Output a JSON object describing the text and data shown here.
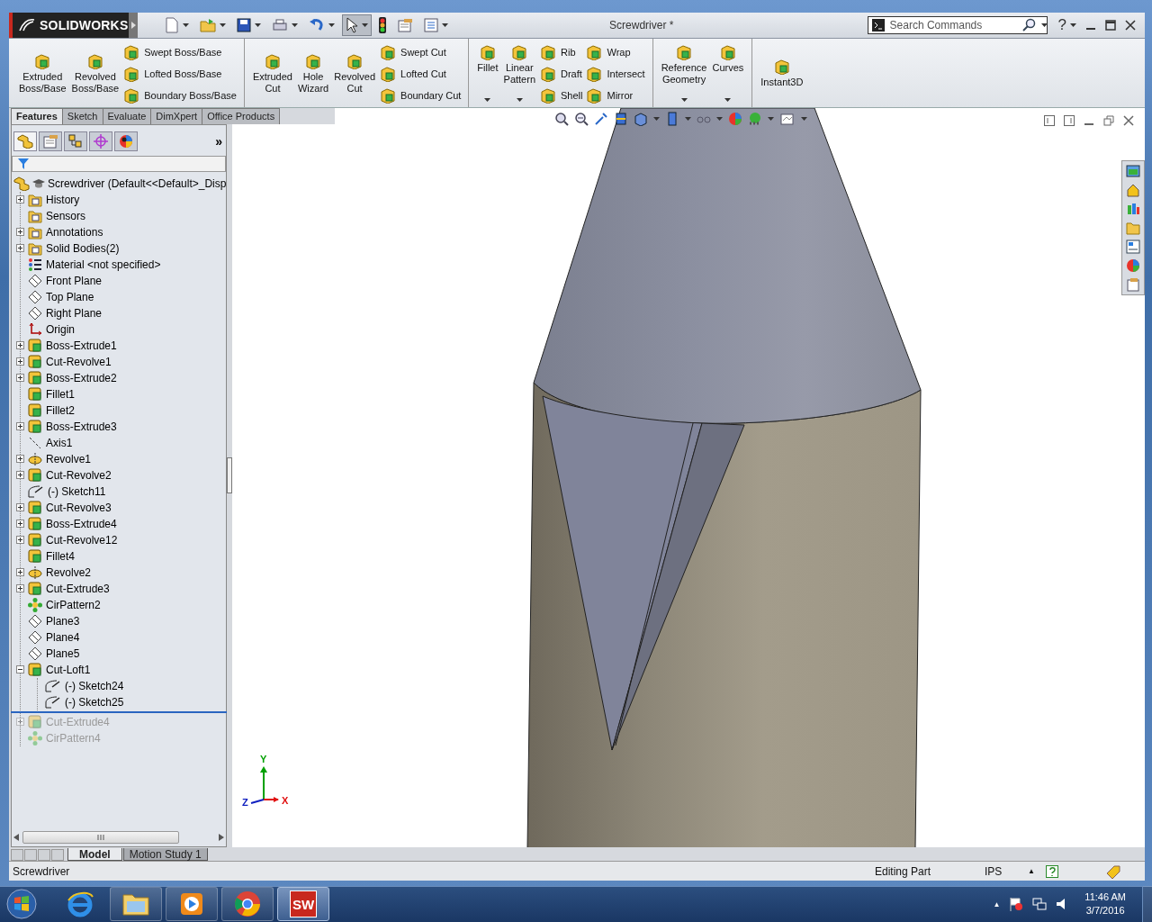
{
  "titlebar": {
    "logo": "SOLIDWORKS",
    "title": "Screwdriver *",
    "search": {
      "placeholder": "Search Commands"
    },
    "help": "?",
    "quick_tools": [
      {
        "kind": "new",
        "dropdown": true,
        "pressed": false
      },
      {
        "kind": "open",
        "dropdown": true,
        "pressed": false
      },
      {
        "kind": "save",
        "dropdown": true,
        "pressed": false
      },
      {
        "kind": "print",
        "dropdown": true,
        "pressed": false
      },
      {
        "kind": "undo",
        "dropdown": true,
        "pressed": false
      },
      {
        "kind": "select",
        "dropdown": true,
        "pressed": true
      },
      {
        "kind": "rebuild",
        "dropdown": false,
        "pressed": false
      },
      {
        "kind": "options",
        "dropdown": false,
        "pressed": false
      },
      {
        "kind": "list",
        "dropdown": true,
        "pressed": false
      }
    ]
  },
  "ribbon": {
    "groups": [
      {
        "columns": [
          {
            "kind": "large",
            "label": "Extruded\nBoss/Base",
            "dropdown": false
          },
          {
            "kind": "large",
            "label": "Revolved\nBoss/Base",
            "dropdown": false
          },
          {
            "kind": "stack",
            "items": [
              {
                "label": "Swept Boss/Base"
              },
              {
                "label": "Lofted Boss/Base"
              },
              {
                "label": "Boundary Boss/Base"
              }
            ]
          }
        ]
      },
      {
        "columns": [
          {
            "kind": "large",
            "label": "Extruded\nCut",
            "dropdown": false
          },
          {
            "kind": "large",
            "label": "Hole\nWizard",
            "dropdown": false
          },
          {
            "kind": "large",
            "label": "Revolved\nCut",
            "dropdown": false
          },
          {
            "kind": "stack",
            "items": [
              {
                "label": "Swept Cut"
              },
              {
                "label": "Lofted Cut"
              },
              {
                "label": "Boundary Cut"
              }
            ]
          }
        ]
      },
      {
        "columns": [
          {
            "kind": "large",
            "label": "Fillet",
            "dropdown": true
          },
          {
            "kind": "large",
            "label": "Linear\nPattern",
            "dropdown": true
          },
          {
            "kind": "stack",
            "items": [
              {
                "label": "Rib"
              },
              {
                "label": "Draft"
              },
              {
                "label": "Shell"
              }
            ]
          },
          {
            "kind": "stack",
            "items": [
              {
                "label": "Wrap"
              },
              {
                "label": "Intersect"
              },
              {
                "label": "Mirror"
              }
            ]
          }
        ]
      },
      {
        "columns": [
          {
            "kind": "large",
            "label": "Reference\nGeometry",
            "dropdown": true
          },
          {
            "kind": "large",
            "label": "Curves",
            "dropdown": true
          }
        ]
      },
      {
        "columns": [
          {
            "kind": "large",
            "label": "Instant3D",
            "dropdown": false
          }
        ]
      }
    ]
  },
  "command_tabs": [
    {
      "label": "Features",
      "selected": true
    },
    {
      "label": "Sketch",
      "selected": false
    },
    {
      "label": "Evaluate",
      "selected": false
    },
    {
      "label": "DimXpert",
      "selected": false
    },
    {
      "label": "Office Products",
      "selected": false
    }
  ],
  "feature_manager": {
    "tabs": [
      {
        "kind": "tree",
        "selected": true
      },
      {
        "kind": "properties",
        "selected": false
      },
      {
        "kind": "configurations",
        "selected": false
      },
      {
        "kind": "target",
        "selected": false
      },
      {
        "kind": "display",
        "selected": false
      }
    ],
    "more": "»",
    "tree": {
      "root": {
        "label": "Screwdriver  (Default<<Default>_Disp"
      },
      "items": [
        {
          "label": "History",
          "kind": "folder",
          "expanded": false,
          "rolled_back": false
        },
        {
          "label": "Sensors",
          "kind": "folder",
          "rolled_back": false
        },
        {
          "label": "Annotations",
          "kind": "folder",
          "expanded": false,
          "rolled_back": false
        },
        {
          "label": "Solid Bodies(2)",
          "kind": "folder",
          "expanded": false,
          "rolled_back": false
        },
        {
          "label": "Material <not specified>",
          "kind": "material",
          "rolled_back": false
        },
        {
          "label": "Front Plane",
          "kind": "plane",
          "rolled_back": false
        },
        {
          "label": "Top Plane",
          "kind": "plane",
          "rolled_back": false
        },
        {
          "label": "Right Plane",
          "kind": "plane",
          "rolled_back": false
        },
        {
          "label": "Origin",
          "kind": "origin",
          "rolled_back": false
        },
        {
          "label": "Boss-Extrude1",
          "kind": "feature",
          "expanded": false,
          "rolled_back": false
        },
        {
          "label": "Cut-Revolve1",
          "kind": "feature",
          "expanded": false,
          "rolled_back": false
        },
        {
          "label": "Boss-Extrude2",
          "kind": "feature",
          "expanded": false,
          "rolled_back": false
        },
        {
          "label": "Fillet1",
          "kind": "feature",
          "rolled_back": false
        },
        {
          "label": "Fillet2",
          "kind": "feature",
          "rolled_back": false
        },
        {
          "label": "Boss-Extrude3",
          "kind": "feature",
          "expanded": false,
          "rolled_back": false
        },
        {
          "label": "Axis1",
          "kind": "axis",
          "rolled_back": false
        },
        {
          "label": "Revolve1",
          "kind": "revolve",
          "expanded": false,
          "rolled_back": false
        },
        {
          "label": "Cut-Revolve2",
          "kind": "feature",
          "expanded": false,
          "rolled_back": false
        },
        {
          "label": "(-) Sketch11",
          "kind": "sketch",
          "rolled_back": false
        },
        {
          "label": "Cut-Revolve3",
          "kind": "feature",
          "expanded": false,
          "rolled_back": false
        },
        {
          "label": "Boss-Extrude4",
          "kind": "feature",
          "expanded": false,
          "rolled_back": false
        },
        {
          "label": "Cut-Revolve12",
          "kind": "feature",
          "expanded": false,
          "rolled_back": false
        },
        {
          "label": "Fillet4",
          "kind": "feature",
          "rolled_back": false
        },
        {
          "label": "Revolve2",
          "kind": "revolve",
          "expanded": false,
          "rolled_back": false
        },
        {
          "label": "Cut-Extrude3",
          "kind": "feature",
          "expanded": false,
          "rolled_back": false
        },
        {
          "label": "CirPattern2",
          "kind": "pattern",
          "rolled_back": false
        },
        {
          "label": "Plane3",
          "kind": "plane",
          "rolled_back": false
        },
        {
          "label": "Plane4",
          "kind": "plane",
          "rolled_back": false
        },
        {
          "label": "Plane5",
          "kind": "plane",
          "rolled_back": false
        },
        {
          "label": "Cut-Loft1",
          "kind": "feature",
          "expanded": true,
          "rolled_back": false,
          "children": [
            {
              "label": "(-) Sketch24",
              "kind": "sketch",
              "rolled_back": false
            },
            {
              "label": "(-) Sketch25",
              "kind": "sketch",
              "rolled_back": false
            }
          ]
        },
        {
          "label": "Cut-Extrude4",
          "kind": "feature",
          "expanded": false,
          "rolled_back": true
        },
        {
          "label": "CirPattern4",
          "kind": "pattern",
          "rolled_back": true
        }
      ]
    }
  },
  "viewport": {
    "triad": [
      {
        "label": "Y",
        "color": "#00a000"
      },
      {
        "label": "Z",
        "color": "#1020c0"
      },
      {
        "label": "X",
        "color": "#e01010"
      }
    ]
  },
  "bottom_tabs": [
    {
      "label": "Model",
      "selected": true
    },
    {
      "label": "Motion Study 1",
      "selected": false
    }
  ],
  "status_bar": {
    "document": "Screwdriver",
    "mode": "Editing Part",
    "units": "IPS",
    "units_arrow": "▲"
  },
  "taskbar": {
    "apps": [
      {
        "kind": "browser",
        "active": false
      },
      {
        "kind": "explorer",
        "active": false
      },
      {
        "kind": "media",
        "active": false
      },
      {
        "kind": "chrome",
        "active": false
      },
      {
        "kind": "solidworks",
        "active": true,
        "mark": "SW"
      }
    ],
    "tray_arrow": "▲",
    "time": "11:46 AM",
    "date": "3/7/2016"
  }
}
